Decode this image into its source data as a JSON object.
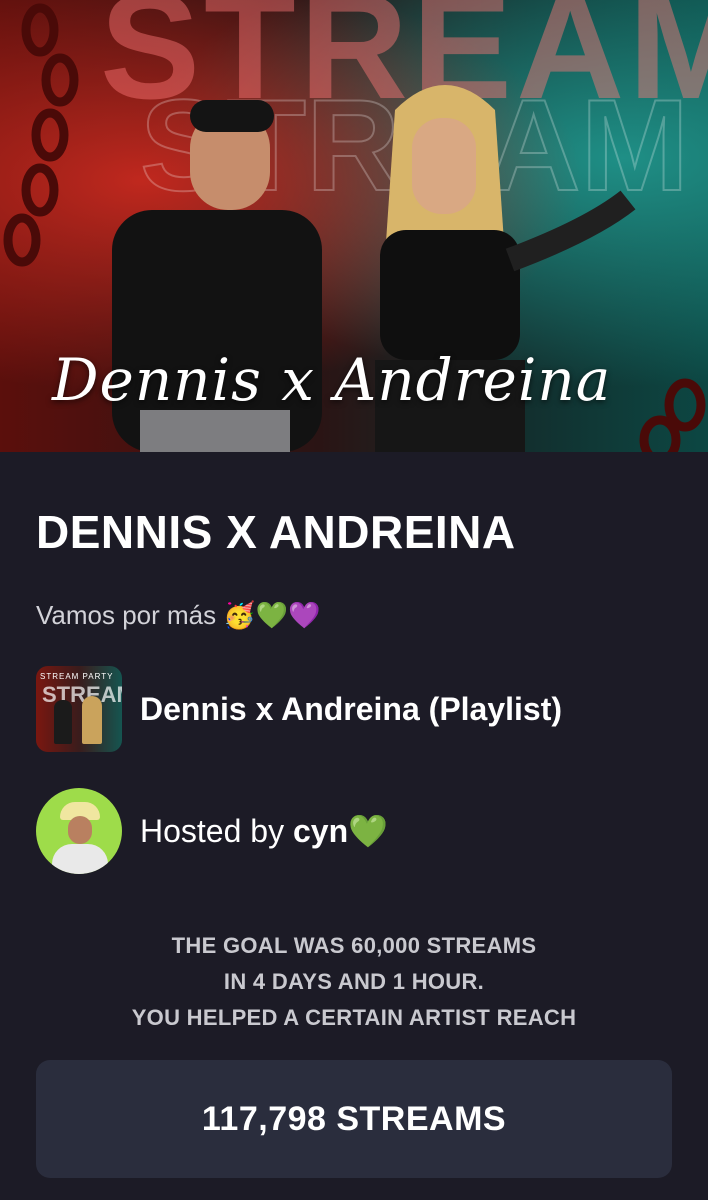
{
  "hero": {
    "banner_word": "STREAM",
    "script_title": "Dennis x Andreina"
  },
  "party": {
    "title": "DENNIS X ANDREINA",
    "description": "Vamos por más 🥳💚💜",
    "playlist": {
      "thumbnail_top_text": "STREAM PARTY",
      "thumbnail_word": "STREAM",
      "name": "Dennis x Andreina (Playlist)"
    },
    "host": {
      "prefix": "Hosted by ",
      "name": "cyn💚"
    },
    "goal_lines": [
      "THE GOAL WAS 60,000 STREAMS",
      "IN 4 DAYS AND 1 HOUR.",
      "YOU HELPED A CERTAIN ARTIST REACH"
    ],
    "streams_total": "117,798 STREAMS"
  },
  "colors": {
    "background": "#1c1b26",
    "card": "#2a2d3d",
    "text": "#ffffff",
    "muted_text": "#c9c9cf"
  },
  "icons": [
    "party-emoji",
    "green-heart-emoji",
    "purple-heart-emoji"
  ]
}
